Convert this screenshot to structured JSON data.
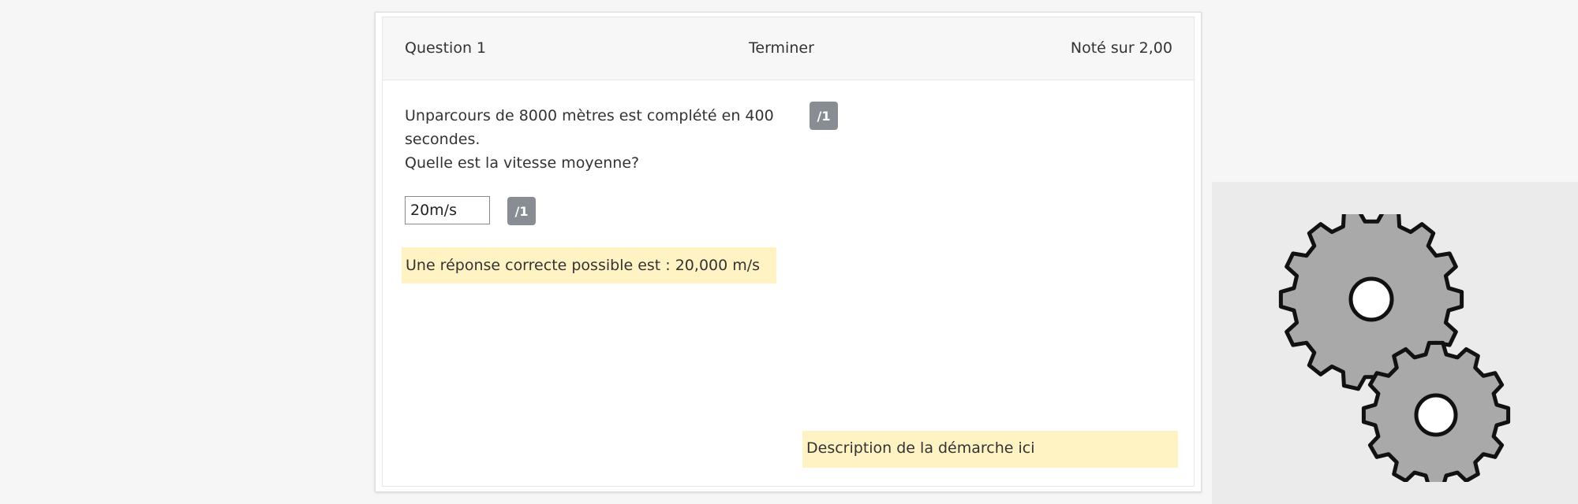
{
  "question": {
    "number_label": "Question 1",
    "status": "Terminer",
    "grade": "Noté sur 2,00",
    "text_line1": "Unparcours de 8000 mètres est complété en 400 secondes.",
    "text_line2": "Quelle est la vitesse moyenne?",
    "answer_value": "20m/s",
    "answer_mark": "/1",
    "feedback": "Une réponse correcte possible est : 20,000 m/s",
    "method_mark": "/1",
    "method_description": "Description de la démarche ici"
  },
  "colors": {
    "feedback_bg": "#fff3c4",
    "badge_bg": "#878d93",
    "gear_fill": "#a9a9a9"
  },
  "icons": {
    "gears": "gears-icon"
  }
}
